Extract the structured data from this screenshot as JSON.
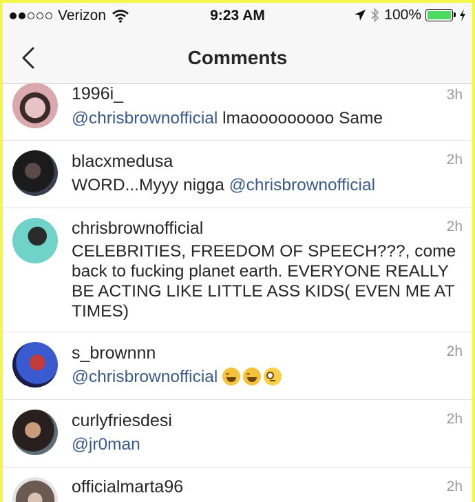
{
  "status_bar": {
    "carrier": "Verizon",
    "time": "9:23 AM",
    "battery": "100%",
    "battery_level": 1.0
  },
  "nav": {
    "title": "Comments",
    "back_icon": "chevron-left-icon"
  },
  "comments": [
    {
      "username": "1996i_",
      "time": "3h",
      "mention": "@chrisbrownofficial",
      "text": " lmaooooooooo Same"
    },
    {
      "username": "blacxmedusa",
      "time": "2h",
      "text": "WORD...Myyy nigga ",
      "mention": "@chrisbrownofficial"
    },
    {
      "username": "chrisbrownofficial",
      "time": "2h",
      "text": "CELEBRITIES, FREEDOM OF SPEECH???, come back to fucking planet earth. EVERYONE REALLY BE ACTING LIKE LITTLE ASS KIDS( EVEN ME AT TIMES)"
    },
    {
      "username": "s_brownnn",
      "time": "2h",
      "mention": "@chrisbrownofficial",
      "emojis": [
        "face-with-tears-of-joy",
        "face-with-tears-of-joy",
        "face-with-rolling-eyes"
      ]
    },
    {
      "username": "curlyfriesdesi",
      "time": "2h",
      "mention": "@jr0man"
    },
    {
      "username": "officialmarta96",
      "time": "2h"
    }
  ],
  "colors": {
    "frame": "#f2f74a",
    "mention": "#3a5a8c",
    "battery": "#4cd964"
  }
}
